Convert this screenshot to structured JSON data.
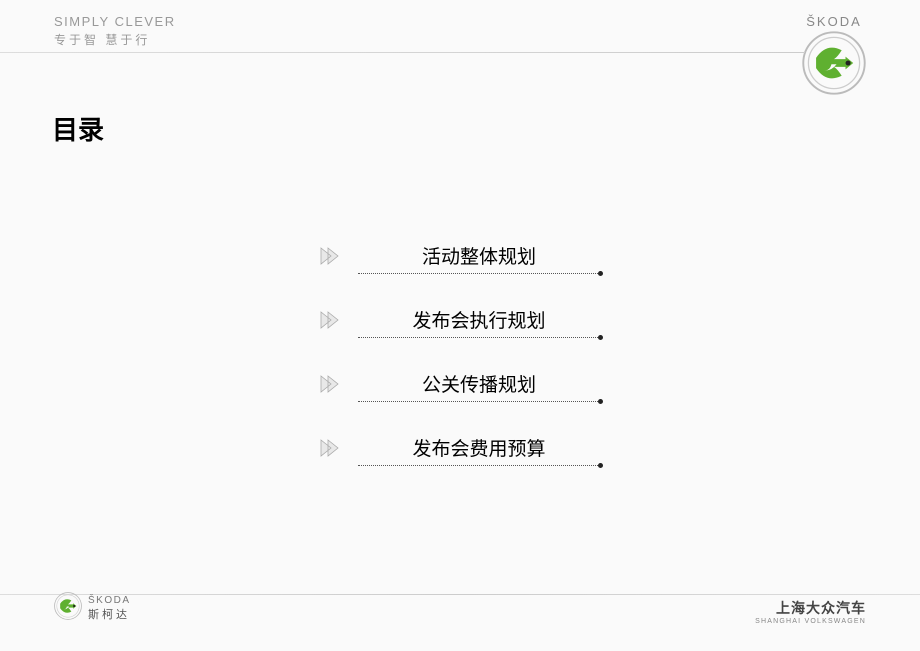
{
  "header": {
    "tagline_en": "SIMPLY CLEVER",
    "tagline_cn": "专于智 慧于行",
    "brand_name": "ŠKODA"
  },
  "title": "目录",
  "toc": {
    "items": [
      {
        "label": "活动整体规划"
      },
      {
        "label": "发布会执行规划"
      },
      {
        "label": "公关传播规划"
      },
      {
        "label": "发布会费用预算"
      }
    ]
  },
  "footer": {
    "left_brand_en": "ŠKODA",
    "left_brand_cn": "斯柯达",
    "right_cn": "上海大众汽车",
    "right_en": "SHANGHAI VOLKSWAGEN"
  },
  "colors": {
    "brand_green": "#5fb030"
  }
}
